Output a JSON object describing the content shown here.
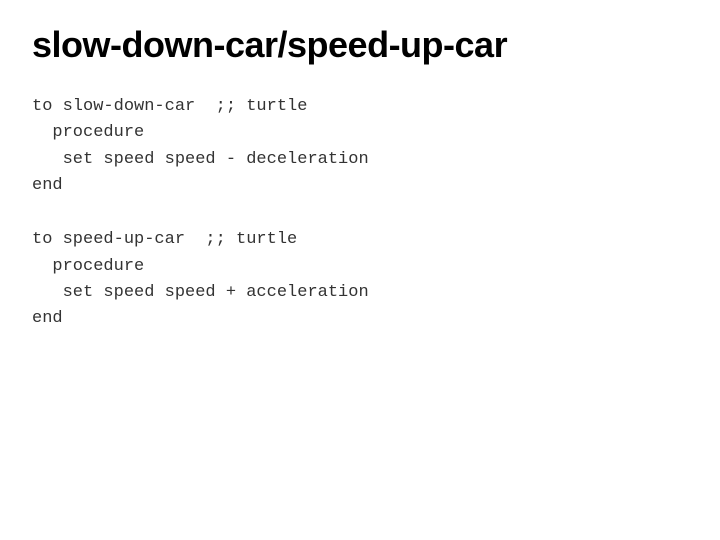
{
  "page": {
    "title": "slow-down-car/speed-up-car",
    "background": "#ffffff"
  },
  "code_sections": [
    {
      "id": "section1",
      "lines": [
        "to slow-down-car  ;; turtle",
        "  procedure",
        "   set speed speed - deceleration",
        "end"
      ]
    },
    {
      "id": "section2",
      "lines": [
        "to speed-up-car  ;; turtle",
        "  procedure",
        "   set speed speed + acceleration",
        "end"
      ]
    }
  ]
}
